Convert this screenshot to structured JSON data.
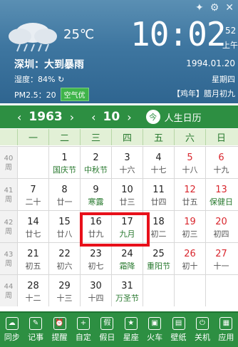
{
  "weather": {
    "temperature": "25℃",
    "city_weather": "深圳：大到暴雨",
    "humidity": "湿度：84%",
    "pm": "PM2.5：20",
    "aqi": "空气优"
  },
  "clock": {
    "time": "10:02",
    "seconds": "52",
    "ampm": "上午",
    "date": "1994.01.20",
    "weekday": "星期四",
    "lunar": "【鸡年】腊月初九"
  },
  "nav": {
    "year": "1963",
    "month": "10",
    "today": "今",
    "life_calendar": "人生日历"
  },
  "weekdays": [
    "一",
    "二",
    "三",
    "四",
    "五",
    "六",
    "日"
  ],
  "weeks": [
    {
      "week": "40",
      "label": "周",
      "days": [
        {
          "d": "",
          "l": ""
        },
        {
          "d": "1",
          "l": "国庆节",
          "fest": true
        },
        {
          "d": "2",
          "l": "中秋节",
          "fest": true
        },
        {
          "d": "3",
          "l": "十六"
        },
        {
          "d": "4",
          "l": "十七"
        },
        {
          "d": "5",
          "l": "十八",
          "red": true
        },
        {
          "d": "6",
          "l": "十九",
          "red": true
        }
      ]
    },
    {
      "week": "41",
      "label": "周",
      "days": [
        {
          "d": "7",
          "l": "二十"
        },
        {
          "d": "8",
          "l": "廿一"
        },
        {
          "d": "9",
          "l": "寒露",
          "fest": true
        },
        {
          "d": "10",
          "l": "廿三"
        },
        {
          "d": "11",
          "l": "廿四"
        },
        {
          "d": "12",
          "l": "廿五",
          "red": true
        },
        {
          "d": "13",
          "l": "保健日",
          "red": true,
          "fest": true
        }
      ]
    },
    {
      "week": "42",
      "label": "周",
      "days": [
        {
          "d": "14",
          "l": "廿七"
        },
        {
          "d": "15",
          "l": "廿八"
        },
        {
          "d": "16",
          "l": "廿九"
        },
        {
          "d": "17",
          "l": "九月",
          "fest": true
        },
        {
          "d": "18",
          "l": "初二"
        },
        {
          "d": "19",
          "l": "初三",
          "red": true
        },
        {
          "d": "20",
          "l": "初四",
          "red": true
        }
      ]
    },
    {
      "week": "43",
      "label": "周",
      "days": [
        {
          "d": "21",
          "l": "初五"
        },
        {
          "d": "22",
          "l": "初六"
        },
        {
          "d": "23",
          "l": "初七"
        },
        {
          "d": "24",
          "l": "霜降",
          "fest": true
        },
        {
          "d": "25",
          "l": "重阳节",
          "fest": true
        },
        {
          "d": "26",
          "l": "初十",
          "red": true
        },
        {
          "d": "27",
          "l": "十一",
          "red": true
        }
      ]
    },
    {
      "week": "44",
      "label": "周",
      "days": [
        {
          "d": "28",
          "l": "十二"
        },
        {
          "d": "29",
          "l": "十三"
        },
        {
          "d": "30",
          "l": "十四"
        },
        {
          "d": "31",
          "l": "万圣节",
          "fest": true
        },
        {
          "d": "",
          "l": ""
        },
        {
          "d": "",
          "l": ""
        },
        {
          "d": "",
          "l": ""
        }
      ]
    }
  ],
  "toolbar": [
    {
      "label": "同步",
      "icon": "cloud-icon",
      "glyph": "☁"
    },
    {
      "label": "记事",
      "icon": "chat-icon",
      "glyph": "✎"
    },
    {
      "label": "提醒",
      "icon": "alarm-icon",
      "glyph": "⏰"
    },
    {
      "label": "自定",
      "icon": "custom-icon",
      "glyph": "+"
    },
    {
      "label": "假日",
      "icon": "holiday-icon",
      "glyph": "假"
    },
    {
      "label": "星座",
      "icon": "star-icon",
      "glyph": "★"
    },
    {
      "label": "火车",
      "icon": "train-icon",
      "glyph": "▣"
    },
    {
      "label": "壁纸",
      "icon": "wallpaper-icon",
      "glyph": "▤"
    },
    {
      "label": "关机",
      "icon": "power-icon",
      "glyph": "⏻"
    },
    {
      "label": "应用",
      "icon": "apps-icon",
      "glyph": "▦"
    }
  ],
  "icons": {
    "puzzle": "puzzle-icon",
    "settings": "gear-icon",
    "close": "close-icon"
  }
}
